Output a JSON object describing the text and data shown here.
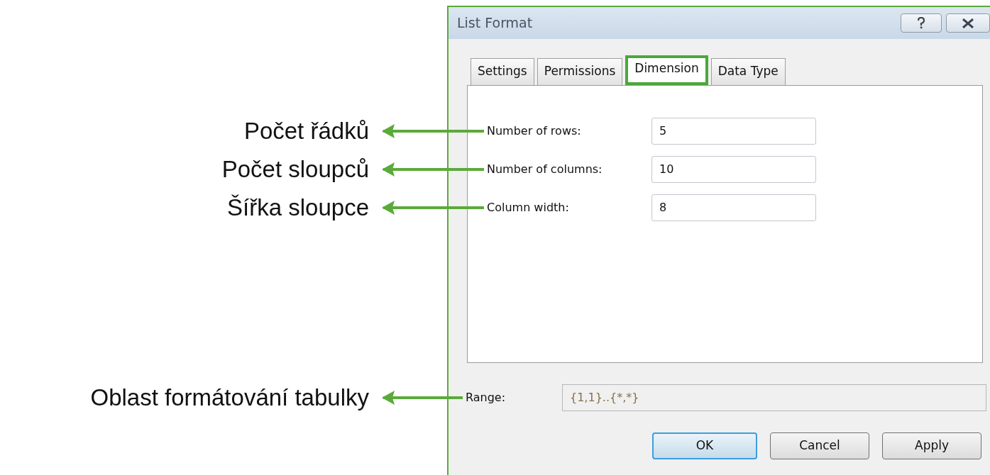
{
  "window": {
    "title": "List Format"
  },
  "title_buttons": [
    {
      "kind": "help"
    },
    {
      "kind": "close"
    }
  ],
  "tabs": [
    {
      "label": "Settings",
      "selected": false
    },
    {
      "label": "Permissions",
      "selected": false
    },
    {
      "label": "Dimension",
      "selected": true
    },
    {
      "label": "Data Type",
      "selected": false
    }
  ],
  "fields": [
    {
      "label": "Number of rows:",
      "value": "5",
      "callout": "Počet řádků"
    },
    {
      "label": "Number of columns:",
      "value": "10",
      "callout": "Počet sloupců"
    },
    {
      "label": "Column width:",
      "value": "8",
      "callout": "Šířka sloupce"
    }
  ],
  "range": {
    "label": "Range:",
    "value": "{1,1}..{*,*}",
    "disabled": true,
    "callout": "Oblast formátování tabulky"
  },
  "buttons": [
    {
      "label": "OK",
      "default": true
    },
    {
      "label": "Cancel",
      "default": false
    },
    {
      "label": "Apply",
      "default": false
    }
  ]
}
